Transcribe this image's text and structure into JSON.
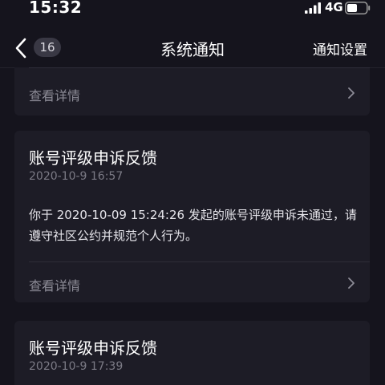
{
  "status_bar": {
    "time": "15:32",
    "network": "4G",
    "icons": [
      "signal-icon",
      "battery-icon"
    ]
  },
  "nav": {
    "back_icon": "chevron-left-icon",
    "unread_count": "16",
    "title": "系统通知",
    "action": "通知设置"
  },
  "notifications": [
    {
      "details_label": "查看详情"
    },
    {
      "title": "账号评级申诉反馈",
      "date": "2020-10-9 16:57",
      "body": "你于 2020-10-09 15:24:26 发起的账号评级申诉未通过，请遵守社区公约并规范个人行为。",
      "details_label": "查看详情"
    },
    {
      "title": "账号评级申诉反馈",
      "date": "2020-10-9 17:39"
    }
  ],
  "colors": {
    "background": "#15141d",
    "card": "#1d1c26",
    "text_primary": "#ffffff",
    "text_secondary": "#7c7b86"
  }
}
